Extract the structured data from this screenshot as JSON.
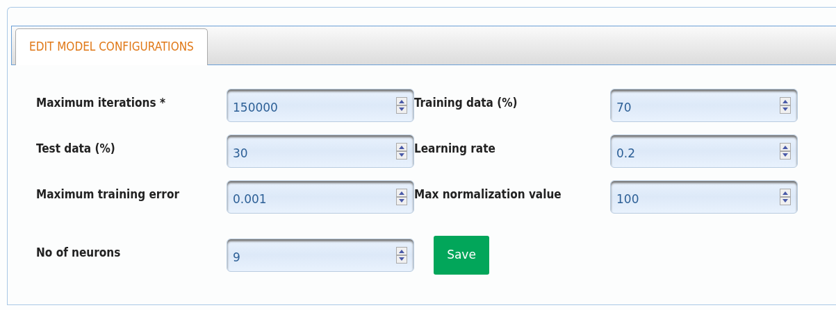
{
  "tabs": [
    {
      "label": "EDIT MODEL CONFIGURATIONS",
      "selected": true
    }
  ],
  "fields": [
    {
      "label": "Maximum iterations *",
      "value": "150000"
    },
    {
      "label": "Training data (%)",
      "value": "70"
    },
    {
      "label": "Test data (%)",
      "value": "30"
    },
    {
      "label": "Learning rate",
      "value": "0.2"
    },
    {
      "label": "Maximum training error",
      "value": "0.001"
    },
    {
      "label": "Max normalization value",
      "value": "100"
    },
    {
      "label": "No of neurons",
      "value": "9"
    }
  ],
  "save_button": "Save"
}
